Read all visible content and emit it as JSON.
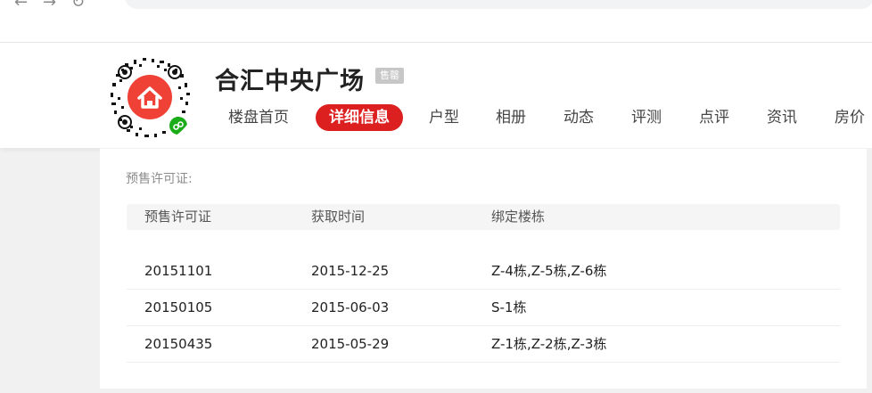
{
  "browser": {
    "back_glyph": "←",
    "forward_glyph": "→",
    "reload_glyph": "↻"
  },
  "project": {
    "title": "合汇中央广场",
    "status_badge": "售罄"
  },
  "tabs": [
    {
      "label": "楼盘首页",
      "active": false
    },
    {
      "label": "详细信息",
      "active": true
    },
    {
      "label": "户型",
      "active": false
    },
    {
      "label": "相册",
      "active": false
    },
    {
      "label": "动态",
      "active": false
    },
    {
      "label": "评测",
      "active": false
    },
    {
      "label": "点评",
      "active": false
    },
    {
      "label": "资讯",
      "active": false
    },
    {
      "label": "房价",
      "active": false
    }
  ],
  "presale": {
    "section_label": "预售许可证:",
    "columns": [
      "预售许可证",
      "获取时间",
      "绑定楼栋"
    ],
    "rows": [
      {
        "license": "20151101",
        "date": "2015-12-25",
        "buildings": "Z-4栋,Z-5栋,Z-6栋"
      },
      {
        "license": "20150105",
        "date": "2015-06-03",
        "buildings": "S-1栋"
      },
      {
        "license": "20150435",
        "date": "2015-05-29",
        "buildings": "Z-1栋,Z-2栋,Z-3栋"
      }
    ]
  },
  "colors": {
    "accent_red": "#dc1f1f",
    "badge_gray": "#c7c7c7",
    "wechat_green": "#1aad19",
    "icon_red": "#ef4136"
  },
  "icons": {
    "qr": "miniprogram-qr-icon",
    "house": "house-icon",
    "miniprogram": "wechat-miniprogram-icon"
  }
}
